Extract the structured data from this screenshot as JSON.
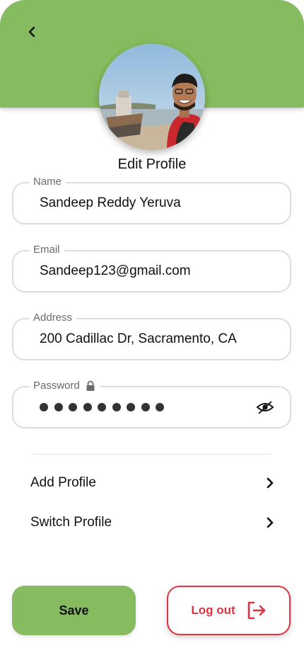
{
  "theme": {
    "accent": "#86bb5f",
    "danger": "#e0333f",
    "border": "#dddddd"
  },
  "header": {
    "back_icon": "chevron-left-icon",
    "avatar_alt": "Profile photo"
  },
  "page_title": "Edit Profile",
  "form": {
    "name": {
      "label": "Name",
      "value": "Sandeep Reddy Yeruva"
    },
    "email": {
      "label": "Email",
      "value": "Sandeep123@gmail.com"
    },
    "address": {
      "label": "Address",
      "value": "200 Cadillac Dr, Sacramento, CA"
    },
    "password": {
      "label": "Password",
      "masked_length": 9,
      "lock_icon": "lock-icon",
      "visibility_icon": "eye-slash-icon"
    }
  },
  "menu": {
    "items": [
      {
        "label": "Add Profile",
        "icon": "chevron-right-icon"
      },
      {
        "label": "Switch Profile",
        "icon": "chevron-right-icon"
      }
    ]
  },
  "actions": {
    "save_label": "Save",
    "logout_label": "Log out",
    "logout_icon": "logout-icon"
  }
}
